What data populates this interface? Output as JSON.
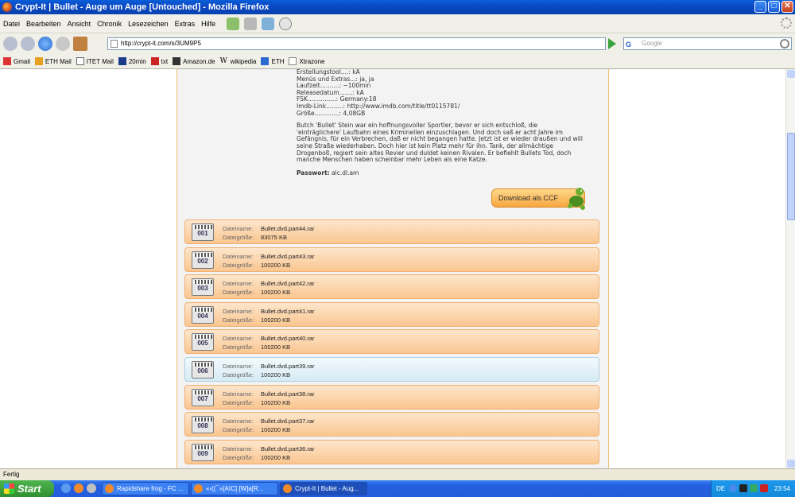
{
  "window": {
    "title": "Crypt-It | Bullet - Auge um Auge [Untouched] - Mozilla Firefox",
    "buttons": {
      "minimize": "_",
      "maximize": "□",
      "close": "✕"
    }
  },
  "menu": [
    "Datei",
    "Bearbeiten",
    "Ansicht",
    "Chronik",
    "Lesezeichen",
    "Extras",
    "Hilfe"
  ],
  "nav": {
    "url": "http://crypt-it.com/s/3UM9P5",
    "search_placeholder": "Google",
    "search_engine_glyph": "G"
  },
  "bookmarks": [
    "Gmail",
    "ETH Mail",
    "ITET Mail",
    "20min",
    "txt",
    "Amazon.de",
    "wikipedia",
    "ETH",
    "Xtrazone"
  ],
  "info_lines": [
    "Erstellungstool....: kA",
    "Menüs und Extras...: ja, ja",
    "Laufzeit..........: ~100min",
    "Releasedatum.......: kA",
    "FSK...............: Germany:18",
    "Imdb-Link.........: http://www.imdb.com/title/tt0115781/",
    "Größe.............: 4,08GB"
  ],
  "description": "Butch 'Bullet' Stein war ein hoffnungsvoller Sportler, bevor er sich entschloß, die 'einträglichere' Laufbahn eines Kriminellen einzuschlagen. Und doch saß er acht Jahre im Gefängnis, für ein Verbrechen, daß er nicht begangen hatte. Jetzt ist er wieder draußen und will seine Straße wiederhaben. Doch hier ist kein Platz mehr für ihn. Tank, der allmächtige Drogenboß, regiert sein altes Revier und duldet keinen Rivalen. Er befiehlt Bullets Tod, doch manche Menschen haben scheinbar mehr Leben als eine Katze.",
  "password": {
    "label": "Passwort:",
    "value": "alc.dl.am"
  },
  "download_button": "Download als CCF",
  "file_labels": {
    "name": "Dateiname:",
    "size": "Dateigröße:"
  },
  "files": [
    {
      "num": "001",
      "name": "Bullet.dvd.part44.rar",
      "size": "83075 KB"
    },
    {
      "num": "002",
      "name": "Bullet.dvd.part43.rar",
      "size": "100200 KB"
    },
    {
      "num": "003",
      "name": "Bullet.dvd.part42.rar",
      "size": "100200 KB"
    },
    {
      "num": "004",
      "name": "Bullet.dvd.part41.rar",
      "size": "100200 KB"
    },
    {
      "num": "005",
      "name": "Bullet.dvd.part40.rar",
      "size": "100200 KB"
    },
    {
      "num": "006",
      "name": "Bullet.dvd.part39.rar",
      "size": "100200 KB"
    },
    {
      "num": "007",
      "name": "Bullet.dvd.part38.rar",
      "size": "100200 KB"
    },
    {
      "num": "008",
      "name": "Bullet.dvd.part37.rar",
      "size": "100200 KB"
    },
    {
      "num": "009",
      "name": "Bullet.dvd.part36.rar",
      "size": "100200 KB"
    }
  ],
  "status": "Fertig",
  "taskbar": {
    "start": "Start",
    "tasks": [
      "Rapidshare frog - FC ...",
      "«‹((¯»[AIC] [W]a[R...",
      "Crypt-It | Bullet - Aug..."
    ],
    "lang": "DE",
    "clock": "23:54"
  },
  "colors": {
    "accent": "#f7a640",
    "highlight_row": "#d6ebf4"
  }
}
